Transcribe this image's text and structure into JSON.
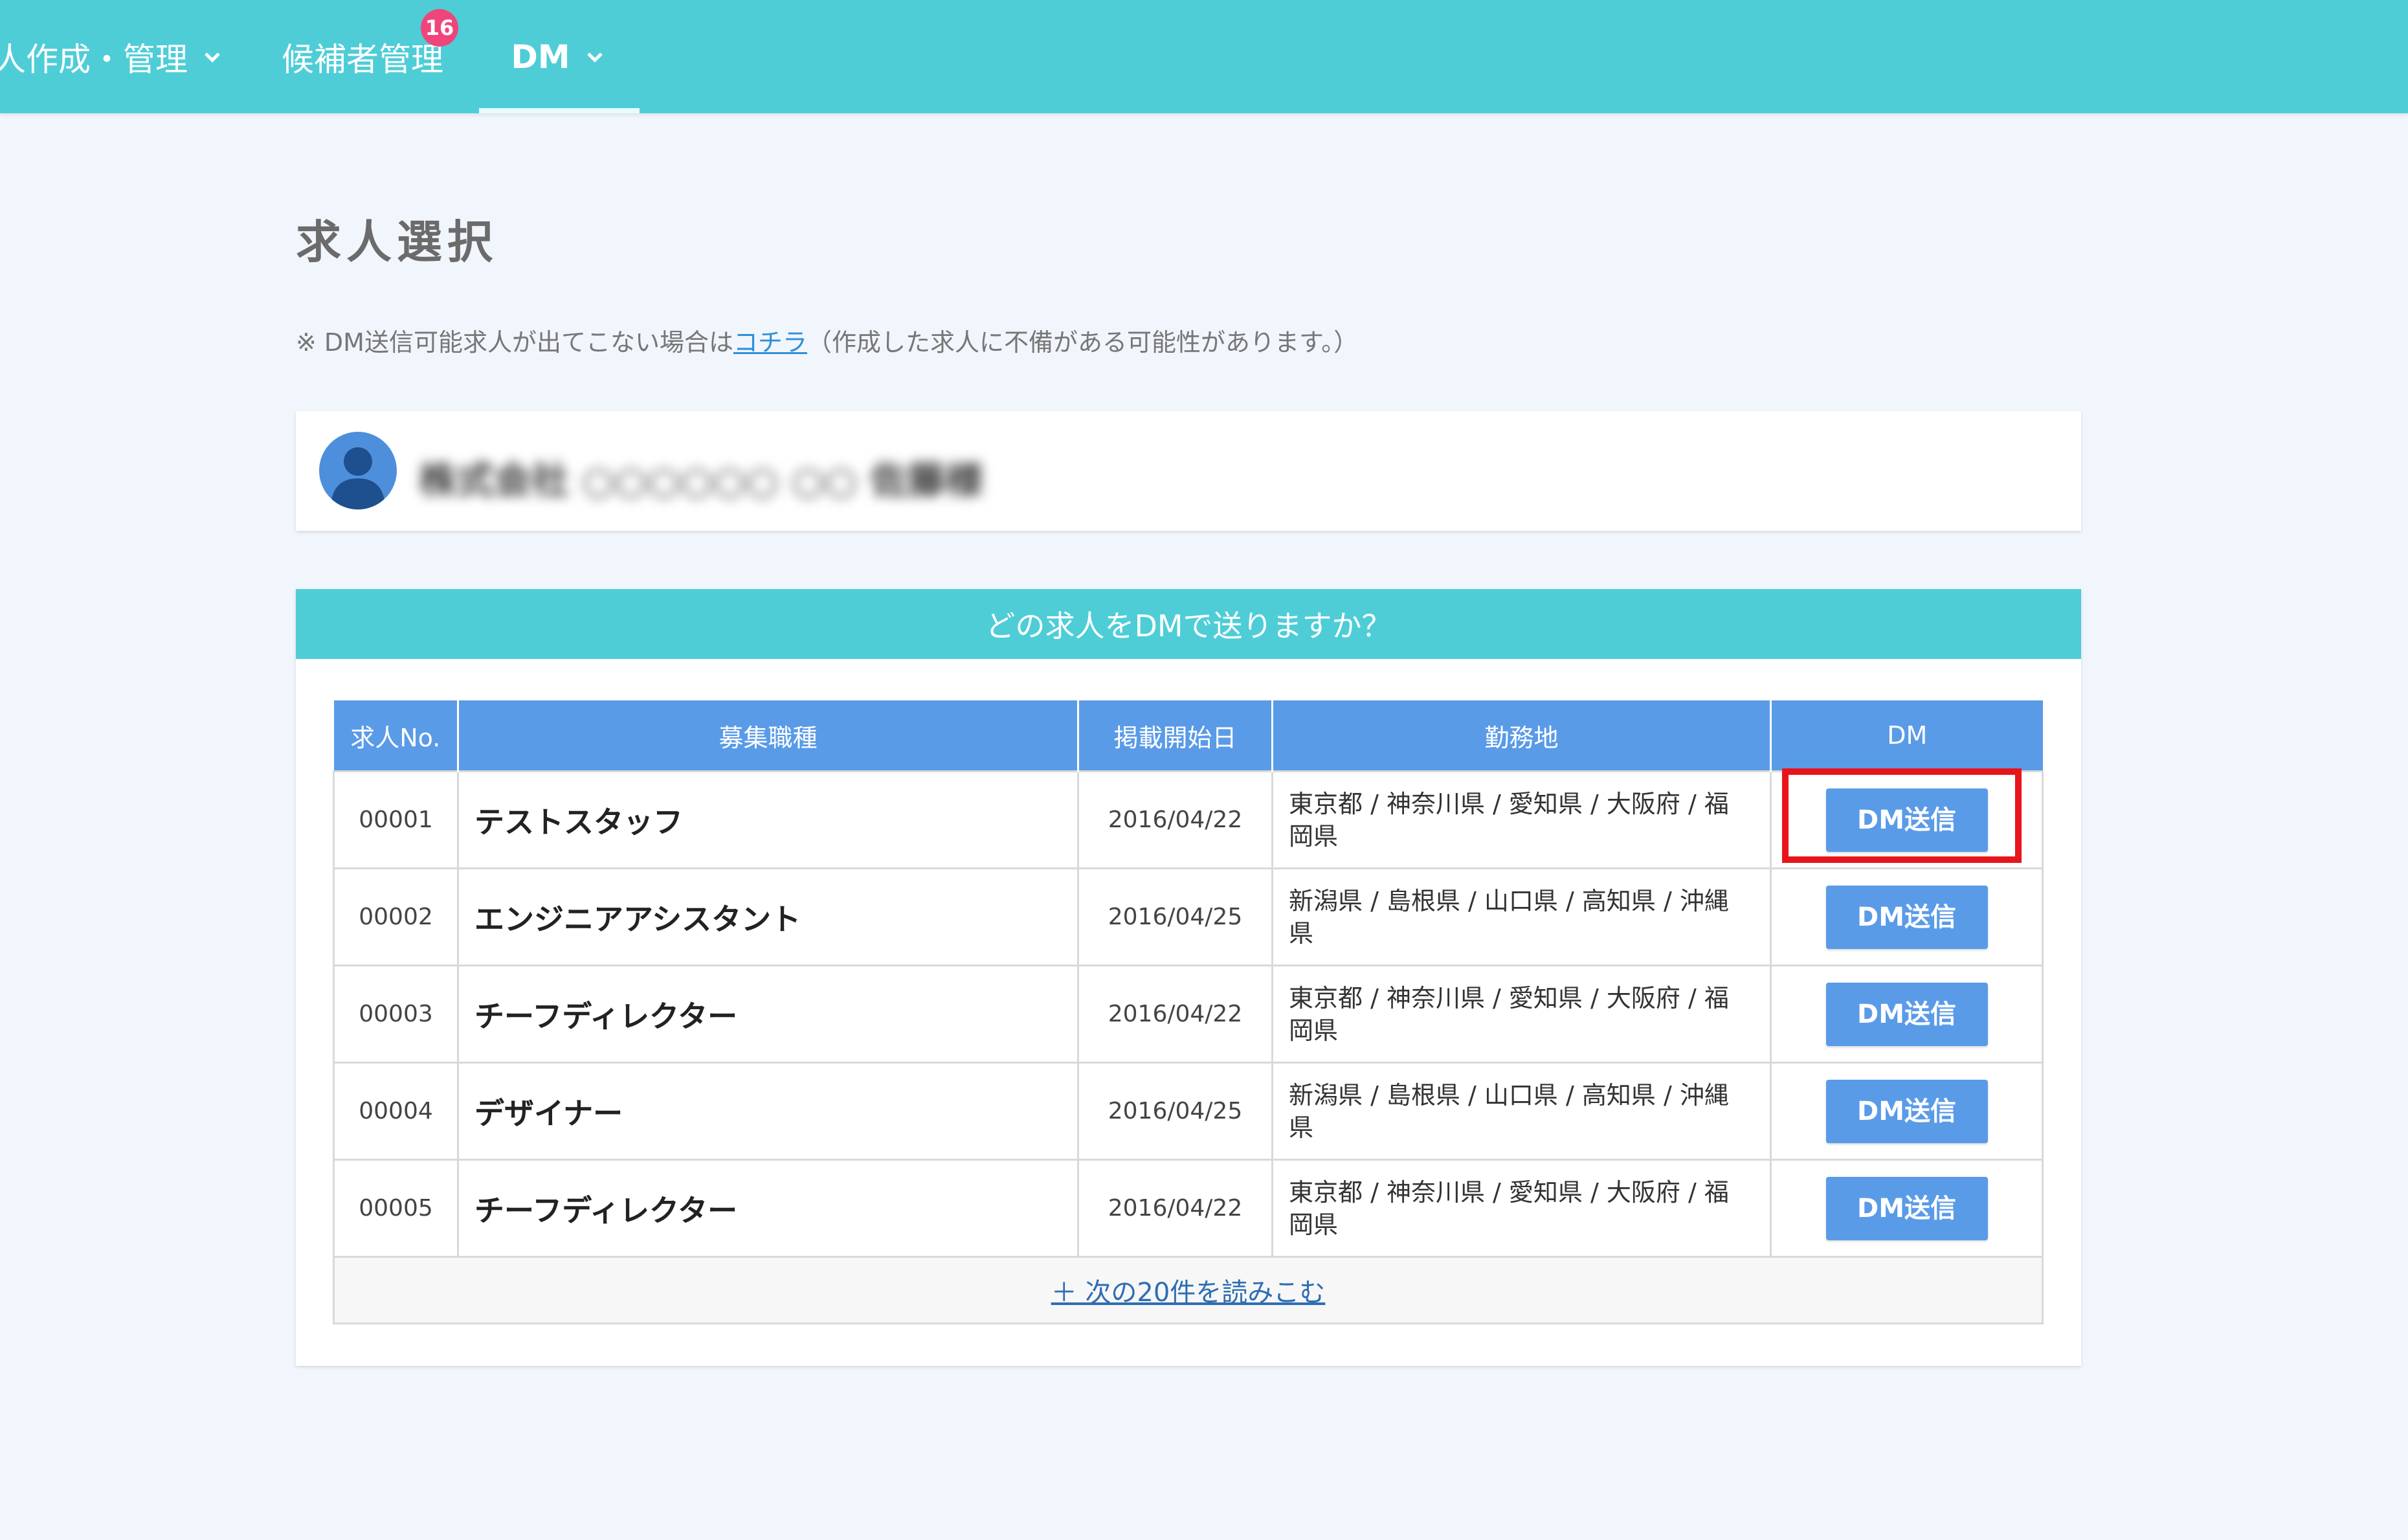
{
  "nav": {
    "items": [
      {
        "label": "人作成・管理"
      },
      {
        "label": "候補者管理",
        "badge": "16"
      },
      {
        "label": "DM"
      }
    ]
  },
  "page": {
    "title": "求人選択",
    "notice_prefix": "※ DM送信可能求人が出てこない場合は",
    "notice_link": "コチラ",
    "notice_suffix": "（作成した求人に不備がある可能性があります。）"
  },
  "user": {
    "name": "株式会社 ○○○○○○ ○○ 佐藤様"
  },
  "panel": {
    "header": "どの求人をDMで送りますか？"
  },
  "table": {
    "columns": [
      "求人No.",
      "募集職種",
      "掲載開始日",
      "勤務地",
      "DM"
    ],
    "rows": [
      {
        "no": "00001",
        "title": "テストスタッフ",
        "date": "2016/04/22",
        "location": "東京都 / 神奈川県 / 愛知県 / 大阪府 / 福岡県",
        "button": "DM送信"
      },
      {
        "no": "00002",
        "title": "エンジニアアシスタント",
        "date": "2016/04/25",
        "location": "新潟県 / 島根県 / 山口県 / 高知県 / 沖縄県",
        "button": "DM送信"
      },
      {
        "no": "00003",
        "title": "チーフディレクター",
        "date": "2016/04/22",
        "location": "東京都 / 神奈川県 / 愛知県 / 大阪府 / 福岡県",
        "button": "DM送信"
      },
      {
        "no": "00004",
        "title": "デザイナー",
        "date": "2016/04/25",
        "location": "新潟県 / 島根県 / 山口県 / 高知県 / 沖縄県",
        "button": "DM送信"
      },
      {
        "no": "00005",
        "title": "チーフディレクター",
        "date": "2016/04/22",
        "location": "東京都 / 神奈川県 / 愛知県 / 大阪府 / 福岡県",
        "button": "DM送信"
      }
    ],
    "load_more": "＋ 次の20件を読みこむ"
  },
  "colors": {
    "nav": "#4ecdd7",
    "table_header": "#5a9be8",
    "badge": "#f0457b",
    "highlight": "#e8141b"
  }
}
